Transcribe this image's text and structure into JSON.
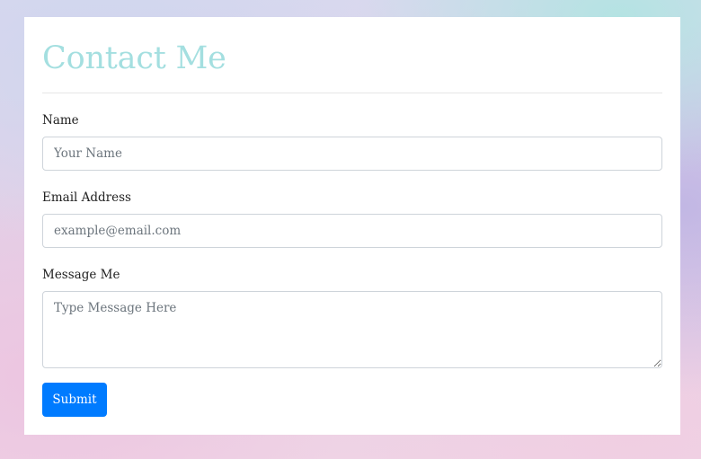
{
  "form": {
    "title": "Contact Me",
    "fields": [
      {
        "label": "Name",
        "placeholder": "Your Name",
        "value": ""
      },
      {
        "label": "Email Address",
        "placeholder": "example@email.com",
        "value": ""
      },
      {
        "label": "Message Me",
        "placeholder": "Type Message Here",
        "value": ""
      }
    ],
    "submit_label": "Submit"
  },
  "colors": {
    "title": "#a4dfe0",
    "submit_button": "#007bff",
    "card_background": "#ffffff",
    "input_border": "#ced4da"
  }
}
